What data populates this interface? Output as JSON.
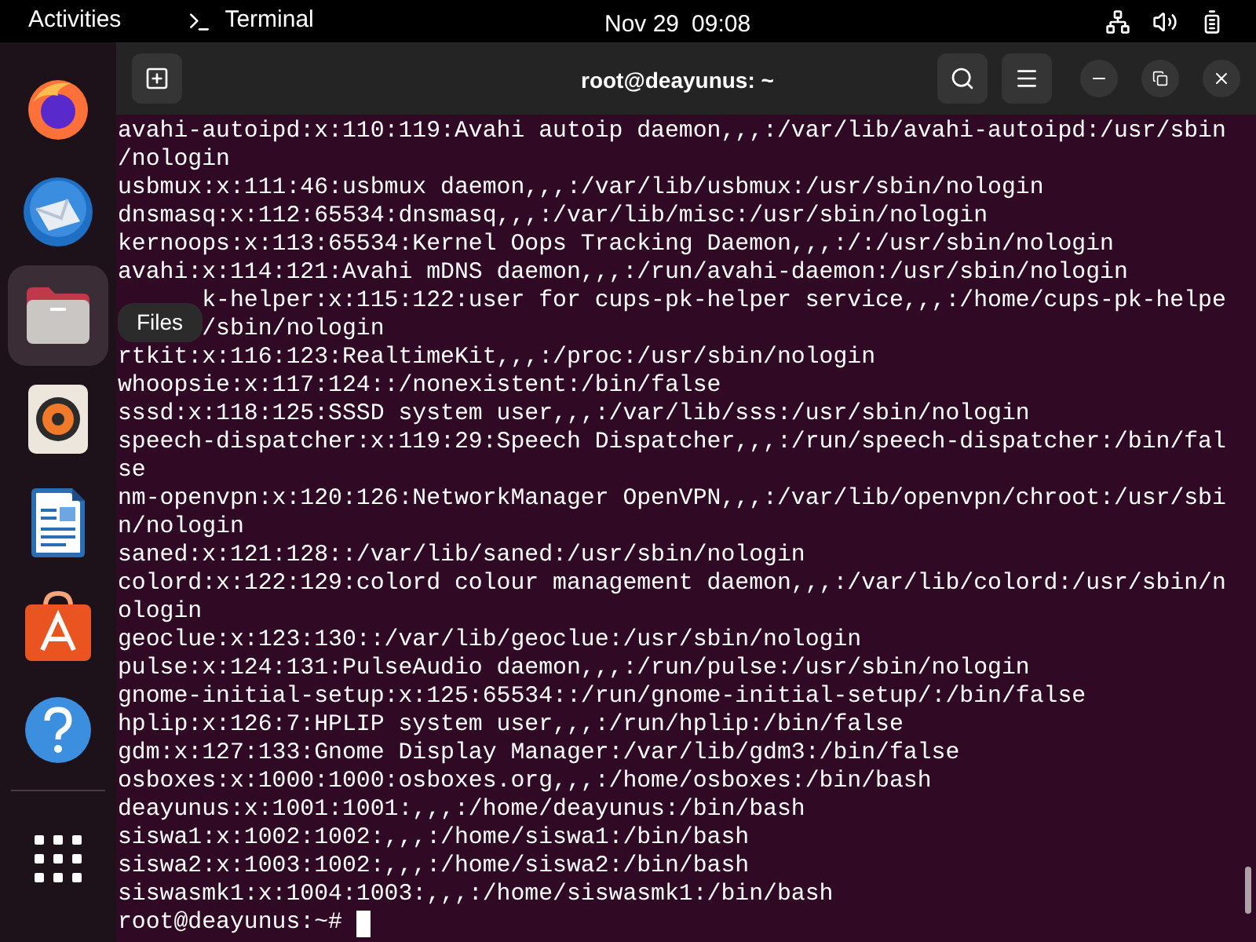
{
  "top_bar": {
    "activities": "Activities",
    "app": "Terminal",
    "date": "Nov 29",
    "time": "09:08"
  },
  "dock": {
    "items": [
      {
        "kind": "firefox",
        "running": false
      },
      {
        "kind": "mail",
        "running": false
      },
      {
        "kind": "files",
        "running": true
      },
      {
        "kind": "speaker",
        "running": false
      },
      {
        "kind": "writer",
        "running": false
      },
      {
        "kind": "store",
        "running": false
      },
      {
        "kind": "help",
        "running": false
      }
    ],
    "tooltip": "Files"
  },
  "window": {
    "title": "root@deayunus: ~"
  },
  "terminal": {
    "lines": [
      {
        "text": "avahi-autoipd:x:110:119:Avahi autoip daemon,,,:/var/lib/avahi-autoipd:/usr/sbin"
      },
      {
        "text": "/nologin"
      },
      {
        "text": "usbmux:x:111:46:usbmux daemon,,,:/var/lib/usbmux:/usr/sbin/nologin"
      },
      {
        "text": "dnsmasq:x:112:65534:dnsmasq,,,:/var/lib/misc:/usr/sbin/nologin"
      },
      {
        "text": "kernoops:x:113:65534:Kernel Oops Tracking Daemon,,,:/:/usr/sbin/nologin"
      },
      {
        "text": "avahi:x:114:121:Avahi mDNS daemon,,,:/run/avahi-daemon:/usr/sbin/nologin"
      },
      {
        "text": "k-helper:x:115:122:user for cups-pk-helper service,,,:/home/cups-pk-helpe",
        "kind": "tail"
      },
      {
        "text": "/sbin/nologin",
        "kind": "tail"
      },
      {
        "text": "rtkit:x:116:123:RealtimeKit,,,:/proc:/usr/sbin/nologin"
      },
      {
        "text": "whoopsie:x:117:124::/nonexistent:/bin/false"
      },
      {
        "text": "sssd:x:118:125:SSSD system user,,,:/var/lib/sss:/usr/sbin/nologin"
      },
      {
        "text": "speech-dispatcher:x:119:29:Speech Dispatcher,,,:/run/speech-dispatcher:/bin/fal"
      },
      {
        "text": "se"
      },
      {
        "text": "nm-openvpn:x:120:126:NetworkManager OpenVPN,,,:/var/lib/openvpn/chroot:/usr/sbi"
      },
      {
        "text": "n/nologin"
      },
      {
        "text": "saned:x:121:128::/var/lib/saned:/usr/sbin/nologin"
      },
      {
        "text": "colord:x:122:129:colord colour management daemon,,,:/var/lib/colord:/usr/sbin/n"
      },
      {
        "text": "ologin"
      },
      {
        "text": "geoclue:x:123:130::/var/lib/geoclue:/usr/sbin/nologin"
      },
      {
        "text": "pulse:x:124:131:PulseAudio daemon,,,:/run/pulse:/usr/sbin/nologin"
      },
      {
        "text": "gnome-initial-setup:x:125:65534::/run/gnome-initial-setup/:/bin/false"
      },
      {
        "text": "hplip:x:126:7:HPLIP system user,,,:/run/hplip:/bin/false"
      },
      {
        "text": "gdm:x:127:133:Gnome Display Manager:/var/lib/gdm3:/bin/false"
      },
      {
        "text": "osboxes:x:1000:1000:osboxes.org,,,:/home/osboxes:/bin/bash"
      },
      {
        "text": "deayunus:x:1001:1001:,,,:/home/deayunus:/bin/bash"
      },
      {
        "text": "siswa1:x:1002:1002:,,,:/home/siswa1:/bin/bash"
      },
      {
        "text": "siswa2:x:1003:1002:,,,:/home/siswa2:/bin/bash"
      },
      {
        "text": "siswasmk1:x:1004:1003:,,,:/home/siswasmk1:/bin/bash"
      }
    ],
    "prompt": "root@deayunus:~#"
  }
}
